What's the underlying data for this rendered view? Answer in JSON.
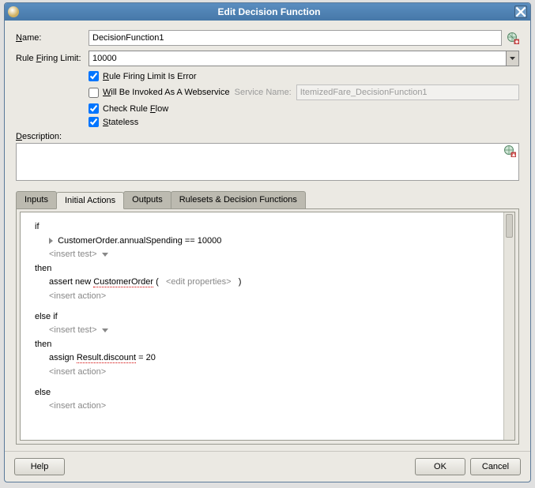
{
  "window": {
    "title": "Edit Decision Function"
  },
  "form": {
    "name_label": "Name:",
    "name_value": "DecisionFunction1",
    "rfl_label": "Rule Firing Limit:",
    "rfl_value": "10000",
    "cb_rfl_error": "Rule Firing Limit Is Error",
    "cb_webservice": "Will Be Invoked As A Webservice",
    "service_name_label": "Service Name:",
    "service_name_value": "ItemizedFare_DecisionFunction1",
    "cb_check_flow": "Check Rule Flow",
    "cb_stateless": "Stateless",
    "description_label": "Description:",
    "description_value": ""
  },
  "tabs": {
    "inputs": "Inputs",
    "initial_actions": "Initial Actions",
    "outputs": "Outputs",
    "rulesets": "Rulesets & Decision Functions"
  },
  "editor": {
    "if": "if",
    "cond1": "CustomerOrder.annualSpending  ==  10000",
    "insert_test": "<insert test>",
    "then": "then",
    "assert_kw": "assert new",
    "assert_obj": "CustomerOrder",
    "assert_paren_open": "(",
    "edit_props": "<edit properties>",
    "assert_paren_close": ")",
    "insert_action": "<insert action>",
    "else_if": "else if",
    "assign_kw": "assign",
    "assign_target": "Result.discount",
    "assign_eq": "= 20",
    "else": "else"
  },
  "footer": {
    "help": "Help",
    "ok": "OK",
    "cancel": "Cancel"
  }
}
